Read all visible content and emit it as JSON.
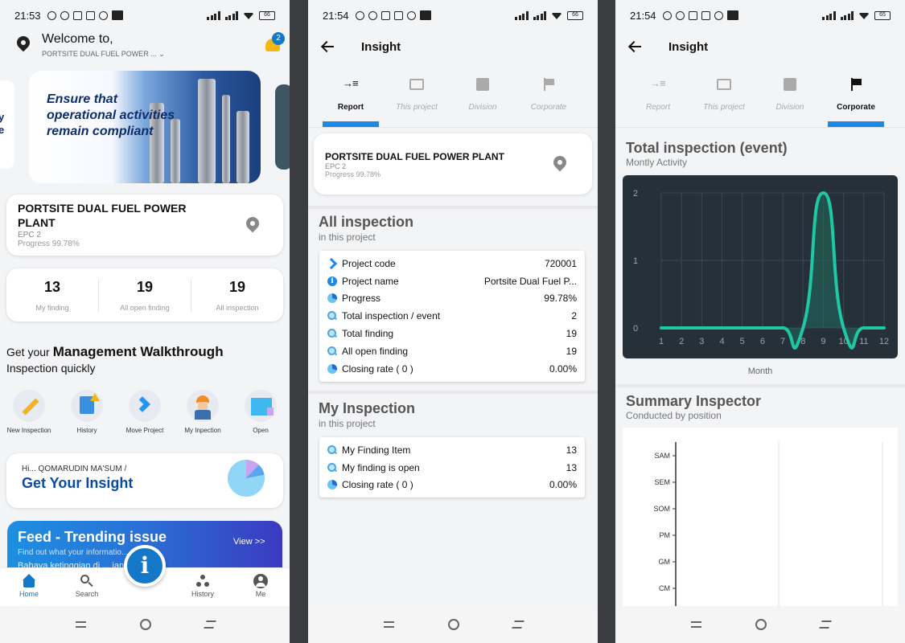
{
  "screen1": {
    "status_time": "21:53",
    "battery": "66",
    "welcome_title": "Welcome to,",
    "welcome_project": "PORTSITE DUAL FUEL POWER ...",
    "notif_count": "2",
    "banner_text": "Ensure that operational activities remain compliant",
    "banner_peek": "y e",
    "project": {
      "name": "PORTSITE DUAL FUEL POWER PLANT",
      "epc": "EPC 2",
      "progress": "Progress 99.78%"
    },
    "stats": [
      {
        "value": "13",
        "label": "My finding"
      },
      {
        "value": "19",
        "label": "All open finding"
      },
      {
        "value": "19",
        "label": "All inspection"
      }
    ],
    "get_your_prefix": "Get your",
    "get_your_title": "Management Walkthrough",
    "get_your_suffix": "Inspection quickly",
    "quick_actions": [
      "New Inspection",
      "History",
      "Move Project",
      "My Inpection",
      "Open"
    ],
    "insight": {
      "greeting": "Hi... QOMARUDIN MA'SUM /",
      "title": "Get Your Insight"
    },
    "feed": {
      "title": "Feed - Trending issue",
      "subtitle": "Find out what your informatio... p to!",
      "body": "Bahaya ketinggian di ... jangan lupa",
      "view": "View >>"
    },
    "bottom_nav": [
      "Home",
      "Search",
      "History",
      "Me"
    ],
    "fab_icon": "i"
  },
  "screen2": {
    "status_time": "21:54",
    "battery": "66",
    "title": "Insight",
    "tabs": [
      "Report",
      "This project",
      "Division",
      "Corporate"
    ],
    "project": {
      "name": "PORTSITE DUAL FUEL POWER PLANT",
      "epc": "EPC 2",
      "progress": "Progress 99.78%"
    },
    "all_inspection": {
      "title": "All inspection",
      "subtitle": "in this project",
      "rows": [
        {
          "icon": "chevron",
          "key": "Project code",
          "value": "720001"
        },
        {
          "icon": "info",
          "key": "Project name",
          "value": "Portsite Dual Fuel P..."
        },
        {
          "icon": "pie",
          "key": "Progress",
          "value": "99.78%"
        },
        {
          "icon": "magnifier",
          "key": "Total inspection / event",
          "value": "2"
        },
        {
          "icon": "magnifier",
          "key": "Total finding",
          "value": "19"
        },
        {
          "icon": "magnifier",
          "key": "All open finding",
          "value": "19"
        },
        {
          "icon": "pie",
          "key": "Closing rate ( 0 )",
          "value": "0.00%"
        }
      ]
    },
    "my_inspection": {
      "title": "My Inspection",
      "subtitle": "in this project",
      "rows": [
        {
          "icon": "magnifier",
          "key": "My Finding Item",
          "value": "13"
        },
        {
          "icon": "magnifier",
          "key": "My finding is open",
          "value": "13"
        },
        {
          "icon": "pie",
          "key": "Closing rate ( 0 )",
          "value": "0.00%"
        }
      ]
    }
  },
  "screen3": {
    "status_time": "21:54",
    "battery": "65",
    "title": "Insight",
    "tabs": [
      "Report",
      "This project",
      "Division",
      "Corporate"
    ],
    "chart1_title": "Total inspection (event)",
    "chart1_subtitle": "Montly Activity",
    "chart2_title": "Summary Inspector",
    "chart2_subtitle": "Conducted by position"
  },
  "chart_data": [
    {
      "type": "line",
      "title": "Total inspection (event)",
      "subtitle": "Montly Activity",
      "xlabel": "Month",
      "ylabel": "",
      "x": [
        1,
        2,
        3,
        4,
        5,
        6,
        7,
        8,
        9,
        10,
        11,
        12
      ],
      "values": [
        0,
        0,
        0,
        0,
        0,
        0,
        0,
        0,
        2,
        0,
        0,
        0
      ],
      "ylim": [
        0,
        2
      ],
      "yticks": [
        0,
        1,
        2
      ],
      "grid": true,
      "colors": {
        "background": "#263038",
        "line": "#1ec8a5",
        "fill": "#1f6b5e"
      }
    },
    {
      "type": "bar",
      "title": "Summary Inspector",
      "subtitle": "Conducted by position",
      "categories": [
        "SAM",
        "SEM",
        "SOM",
        "PM",
        "GM",
        "CM"
      ],
      "values": [
        0,
        0,
        0,
        0,
        0,
        0
      ],
      "orientation": "horizontal",
      "grid": true
    }
  ],
  "colors": {
    "accent": "#1e88e5",
    "brand_blue": "#0b4aa6",
    "bell": "#f2b712"
  }
}
